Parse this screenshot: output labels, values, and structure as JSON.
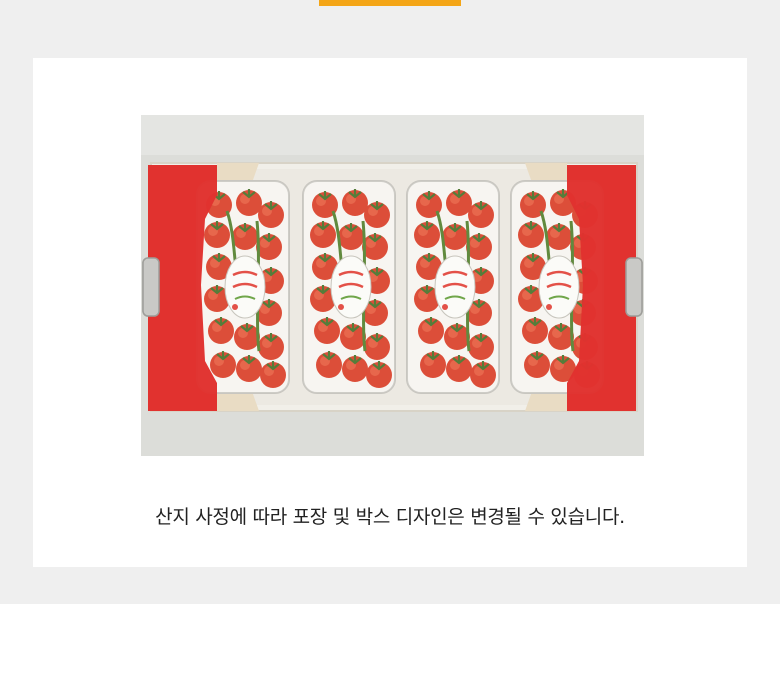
{
  "colors": {
    "accent": "#f4a516",
    "background_band": "#efefef",
    "card": "#ffffff",
    "box_red": "#e0322f"
  },
  "product_image": {
    "content": "box-of-cherry-tomato-punnets",
    "punnet_count": 4
  },
  "caption": "산지 사정에 따라 포장 및 박스 디자인은 변경될 수 있습니다."
}
